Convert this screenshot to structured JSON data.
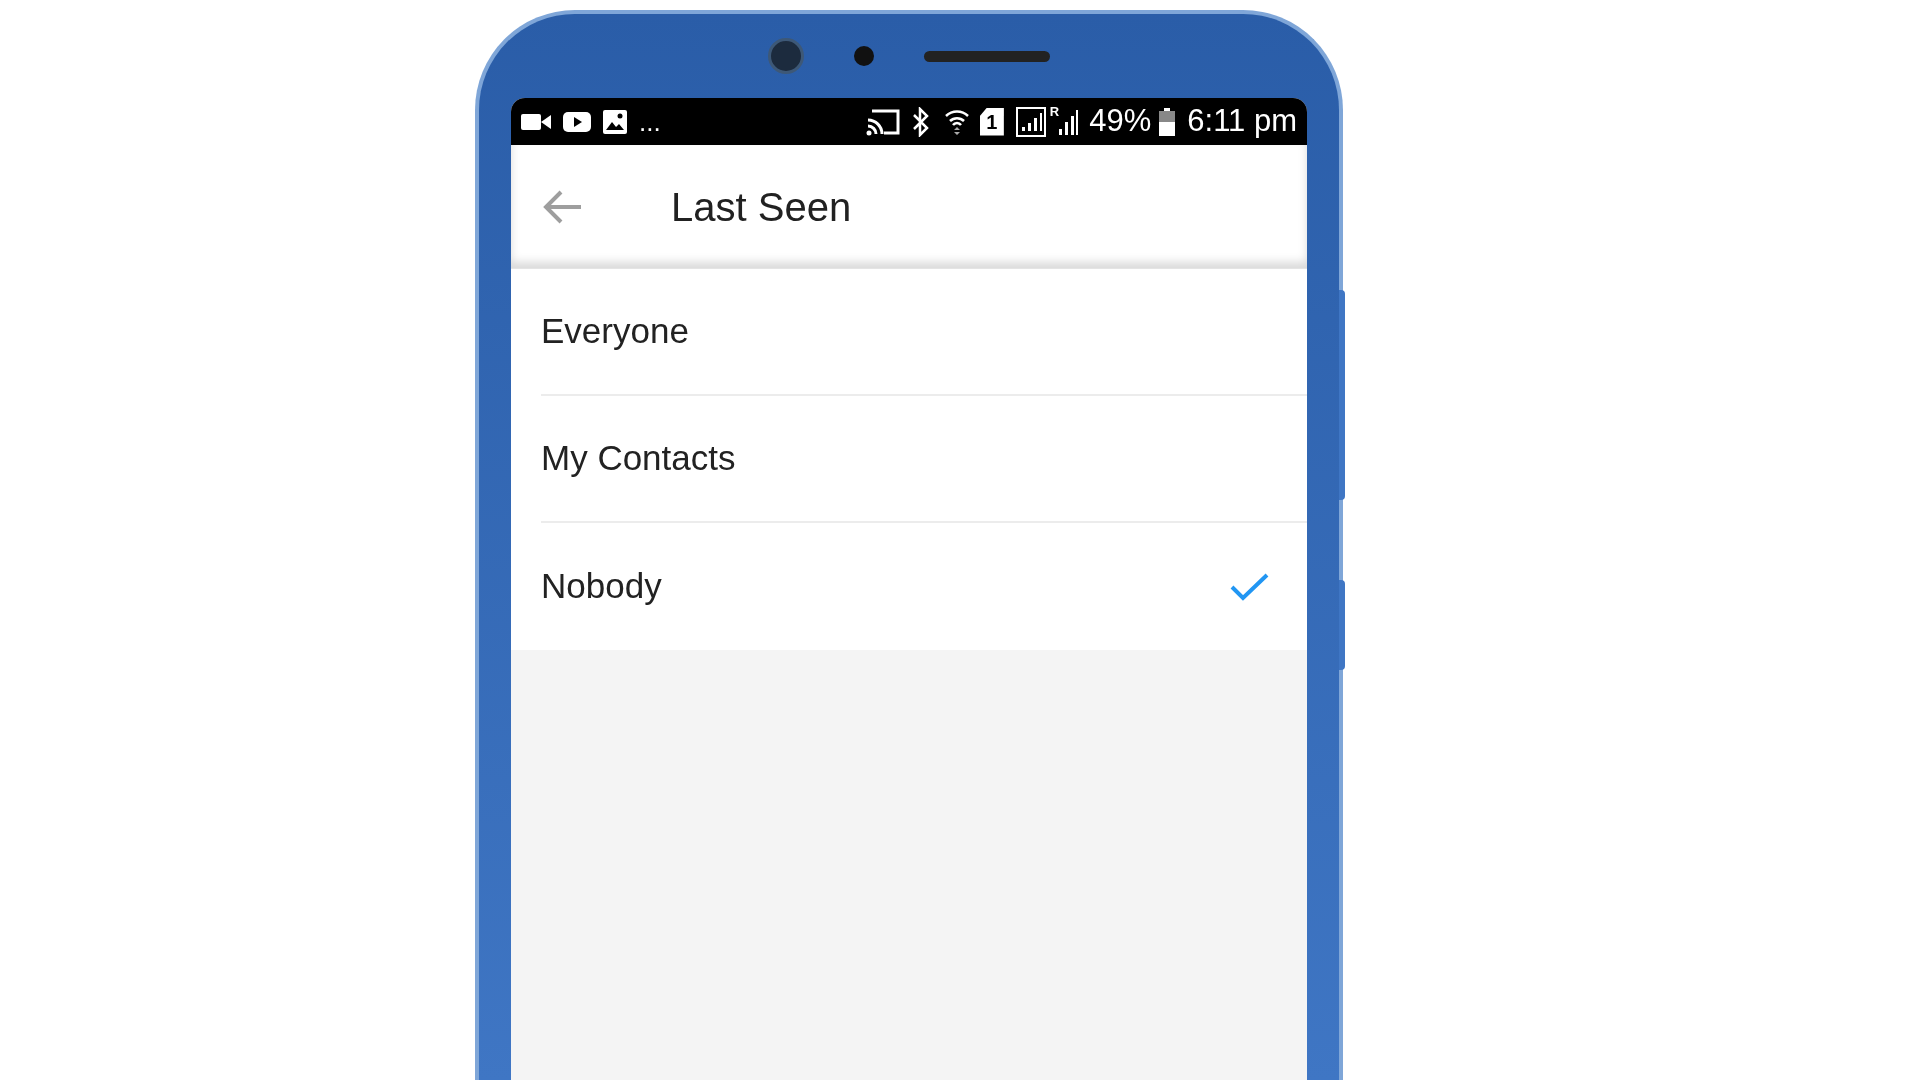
{
  "status_bar": {
    "overflow": "...",
    "sim": "1",
    "roaming": "R",
    "battery": "49%",
    "time": "6:11 pm"
  },
  "header": {
    "title": "Last Seen"
  },
  "options": [
    {
      "label": "Everyone",
      "selected": false
    },
    {
      "label": "My Contacts",
      "selected": false
    },
    {
      "label": "Nobody",
      "selected": true
    }
  ]
}
